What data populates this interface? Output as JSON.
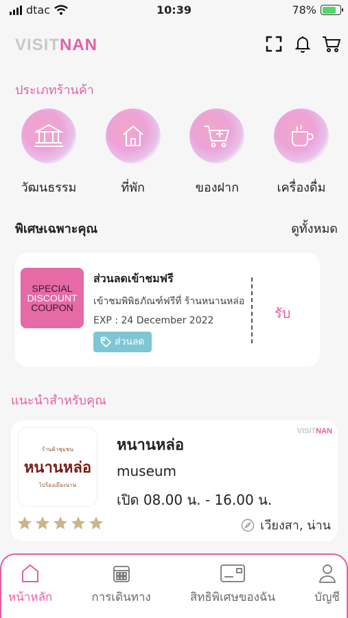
{
  "status_bar": {
    "carrier": "dtac",
    "time": "10:39",
    "battery": "78%",
    "battery_level": 0.78
  },
  "header": {
    "logo_part1": "VISIT",
    "logo_part2": "NAN",
    "icons": [
      "scan-icon",
      "bell-icon",
      "cart-icon"
    ]
  },
  "categories": {
    "title": "ประเภทร้านค้า",
    "items": [
      {
        "label": "วัฒนธรรม",
        "icon": "temple-icon"
      },
      {
        "label": "ที่พัก",
        "icon": "house-icon"
      },
      {
        "label": "ของฝาก",
        "icon": "cart-icon"
      },
      {
        "label": "เครื่องดื่ม",
        "icon": "cup-icon"
      }
    ]
  },
  "special": {
    "title": "พิเศษเฉพาะคุณ",
    "see_all": "ดูทั้งหมด",
    "coupon": {
      "image_lines": [
        "SPECIAL",
        "DISCOUNT",
        "COUPON"
      ],
      "title": "ส่วนลดเข้าชมฟรี",
      "description": "เข้าชมพิพิธภัณฑ์ฟรีที่ ร้านหนานหล่อ",
      "expiry": "EXP : 24 December 2022",
      "tag": "ส่วนลด",
      "claim": "รับ"
    }
  },
  "recommended": {
    "title": "แนะนำสำหรับคุณ",
    "place": {
      "logo_lines": [
        "ร้านค้าชุมชน",
        "หนานหล่อ",
        "ไปร้องเมืองน่าน"
      ],
      "watermark_part1": "VISIT",
      "watermark_part2": "NAN",
      "name": "หนานหล่อ",
      "type": "museum",
      "hours": "เปิด 08.00 น. - 16.00 น.",
      "rating": 5,
      "location": "เวียงสา, น่าน"
    }
  },
  "bottom_nav": {
    "items": [
      {
        "label": "หน้าหลัก",
        "icon": "home-icon",
        "active": true
      },
      {
        "label": "การเดินทาง",
        "icon": "calendar-icon",
        "active": false
      },
      {
        "label": "สิทธิพิเศษของฉัน",
        "icon": "card-icon",
        "active": false
      },
      {
        "label": "บัญชี",
        "icon": "user-icon",
        "active": false
      }
    ]
  },
  "colors": {
    "accent": "#e45ea4",
    "tag": "#7ec6d4",
    "star": "#c9b68a"
  }
}
